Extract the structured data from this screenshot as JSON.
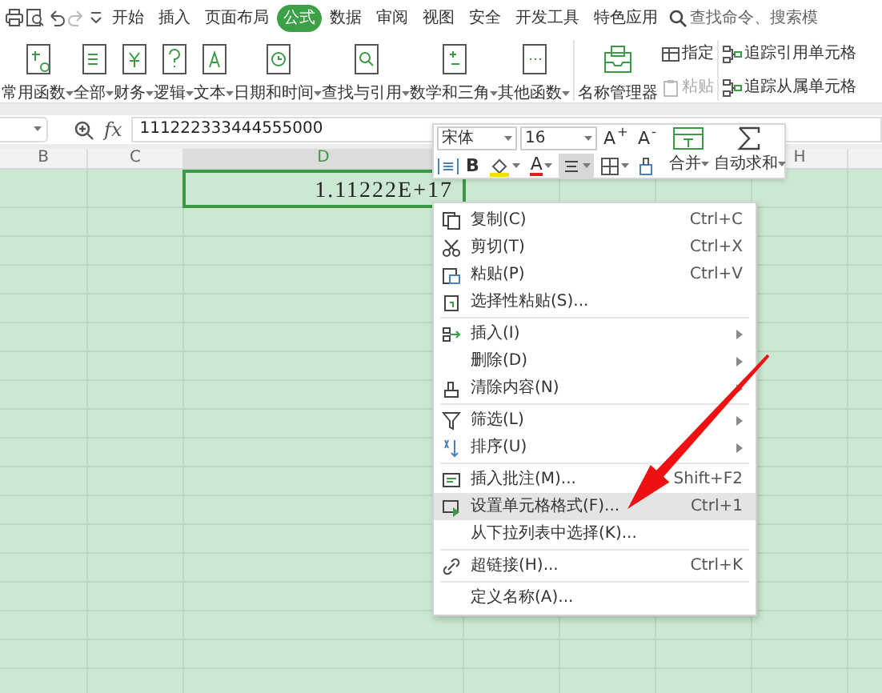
{
  "menu_tabs": [
    {
      "label": "开始",
      "selected": false
    },
    {
      "label": "插入",
      "selected": false
    },
    {
      "label": "页面布局",
      "selected": false
    },
    {
      "label": "公式",
      "selected": true
    },
    {
      "label": "数据",
      "selected": false
    },
    {
      "label": "审阅",
      "selected": false
    },
    {
      "label": "视图",
      "selected": false
    },
    {
      "label": "安全",
      "selected": false
    },
    {
      "label": "开发工具",
      "selected": false
    },
    {
      "label": "特色应用",
      "selected": false
    }
  ],
  "search": {
    "placeholder": "查找命令、搜索模"
  },
  "ribbon": {
    "function_buttons": [
      {
        "label": "常用函数"
      },
      {
        "label": "全部"
      },
      {
        "label": "财务"
      },
      {
        "label": "逻辑"
      },
      {
        "label": "文本"
      },
      {
        "label": "日期和时间"
      },
      {
        "label": "查找与引用"
      },
      {
        "label": "数学和三角"
      },
      {
        "label": "其他函数"
      }
    ],
    "name_manager": {
      "label": "名称管理器"
    },
    "small_buttons": [
      {
        "label": "指定",
        "disabled": false
      },
      {
        "label": "粘贴",
        "disabled": true
      }
    ],
    "trace_buttons": [
      {
        "label": "追踪引用单元格"
      },
      {
        "label": "追踪从属单元格"
      }
    ]
  },
  "formula_bar": {
    "fx_label": "fx",
    "value": "111222333444555000"
  },
  "columns": [
    {
      "label": "B",
      "selected": false
    },
    {
      "label": "C",
      "selected": false
    },
    {
      "label": "D",
      "selected": true
    },
    {
      "label": "H",
      "selected": false
    }
  ],
  "active_cell": {
    "value": "1.11222E+17"
  },
  "mini_toolbar": {
    "font": "宋体",
    "size": "16",
    "font_grow": "A$^{+}$",
    "font_shrink": "A$^{-}$",
    "bold": "B",
    "font_color": "A",
    "center_selected": true,
    "merge": "合并",
    "autosum": "自动求和"
  },
  "context_menu": {
    "items": [
      {
        "label": "复制(C)",
        "shortcut": "Ctrl+C",
        "submenu": false,
        "selected": false,
        "divider_after": false
      },
      {
        "label": "剪切(T)",
        "shortcut": "Ctrl+X",
        "submenu": false,
        "selected": false,
        "divider_after": false
      },
      {
        "label": "粘贴(P)",
        "shortcut": "Ctrl+V",
        "submenu": false,
        "selected": false,
        "divider_after": false
      },
      {
        "label": "选择性粘贴(S)...",
        "submenu": false,
        "selected": false,
        "divider_after": true
      },
      {
        "label": "插入(I)",
        "submenu": true,
        "selected": false,
        "divider_after": false
      },
      {
        "label": "删除(D)",
        "submenu": true,
        "selected": false,
        "divider_after": false
      },
      {
        "label": "清除内容(N)",
        "submenu": true,
        "selected": false,
        "divider_after": true
      },
      {
        "label": "筛选(L)",
        "submenu": true,
        "selected": false,
        "divider_after": false
      },
      {
        "label": "排序(U)",
        "submenu": true,
        "selected": false,
        "divider_after": true
      },
      {
        "label": "插入批注(M)...",
        "shortcut": "Shift+F2",
        "submenu": false,
        "selected": false,
        "divider_after": false
      },
      {
        "label": "设置单元格格式(F)...",
        "shortcut": "Ctrl+1",
        "submenu": false,
        "selected": true,
        "divider_after": false
      },
      {
        "label": "从下拉列表中选择(K)...",
        "submenu": false,
        "selected": false,
        "divider_after": true
      },
      {
        "label": "超链接(H)...",
        "shortcut": "Ctrl+K",
        "submenu": false,
        "selected": false,
        "divider_after": true
      },
      {
        "label": "定义名称(A)...",
        "submenu": false,
        "selected": false,
        "divider_after": false
      }
    ]
  }
}
